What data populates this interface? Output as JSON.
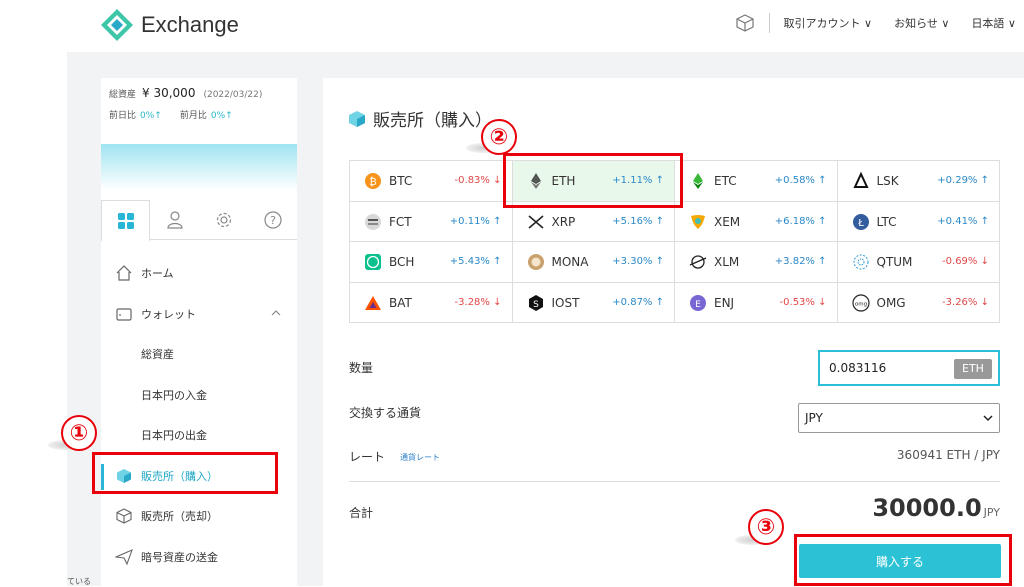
{
  "header": {
    "brand": "Exchange",
    "nav": [
      "取引アカウント ∨",
      "お知らせ ∨",
      "日本語 ∨"
    ]
  },
  "sidebar": {
    "total_label": "総資産",
    "total_value": "¥ 30,000",
    "total_date": "(2022/03/22)",
    "day_label": "前日比",
    "day_value": "0%↑",
    "month_label": "前月比",
    "month_value": "0%↑",
    "menu": [
      {
        "label": "ホーム"
      },
      {
        "label": "ウォレット"
      },
      {
        "label": "総資産"
      },
      {
        "label": "日本円の入金"
      },
      {
        "label": "日本円の出金"
      },
      {
        "label": "販売所（購入）"
      },
      {
        "label": "販売所（売却）"
      },
      {
        "label": "暗号資産の送金"
      }
    ],
    "bottom_text": "ている"
  },
  "main": {
    "title": "販売所（購入）",
    "coins": [
      [
        {
          "symbol": "BTC",
          "change": "-0.83%",
          "dir": "down"
        },
        {
          "symbol": "ETH",
          "change": "+1.11%",
          "dir": "up"
        },
        {
          "symbol": "ETC",
          "change": "+0.58%",
          "dir": "up"
        },
        {
          "symbol": "LSK",
          "change": "+0.29%",
          "dir": "up"
        }
      ],
      [
        {
          "symbol": "FCT",
          "change": "+0.11%",
          "dir": "up"
        },
        {
          "symbol": "XRP",
          "change": "+5.16%",
          "dir": "up"
        },
        {
          "symbol": "XEM",
          "change": "+6.18%",
          "dir": "up"
        },
        {
          "symbol": "LTC",
          "change": "+0.41%",
          "dir": "up"
        }
      ],
      [
        {
          "symbol": "BCH",
          "change": "+5.43%",
          "dir": "up"
        },
        {
          "symbol": "MONA",
          "change": "+3.30%",
          "dir": "up"
        },
        {
          "symbol": "XLM",
          "change": "+3.82%",
          "dir": "up"
        },
        {
          "symbol": "QTUM",
          "change": "-0.69%",
          "dir": "down"
        }
      ],
      [
        {
          "symbol": "BAT",
          "change": "-3.28%",
          "dir": "down"
        },
        {
          "symbol": "IOST",
          "change": "+0.87%",
          "dir": "up"
        },
        {
          "symbol": "ENJ",
          "change": "-0.53%",
          "dir": "down"
        },
        {
          "symbol": "OMG",
          "change": "-3.26%",
          "dir": "down"
        }
      ]
    ],
    "selected": "ETH",
    "qty_label": "数量",
    "qty_value": "0.083116",
    "qty_unit": "ETH",
    "ccy_label": "交換する通貨",
    "ccy_value": "JPY",
    "rate_label": "レート",
    "rate_link": "通貨レート",
    "rate_value": "360941  ETH / JPY",
    "total_label": "合計",
    "total_value": "30000.0",
    "total_unit": "JPY",
    "buy_label": "購入する"
  },
  "markers": [
    "①",
    "②",
    "③"
  ],
  "colors": {
    "accent": "#2cc2d6",
    "up": "#2a88c8",
    "down": "#e04848",
    "annotation": "#e8000b"
  }
}
